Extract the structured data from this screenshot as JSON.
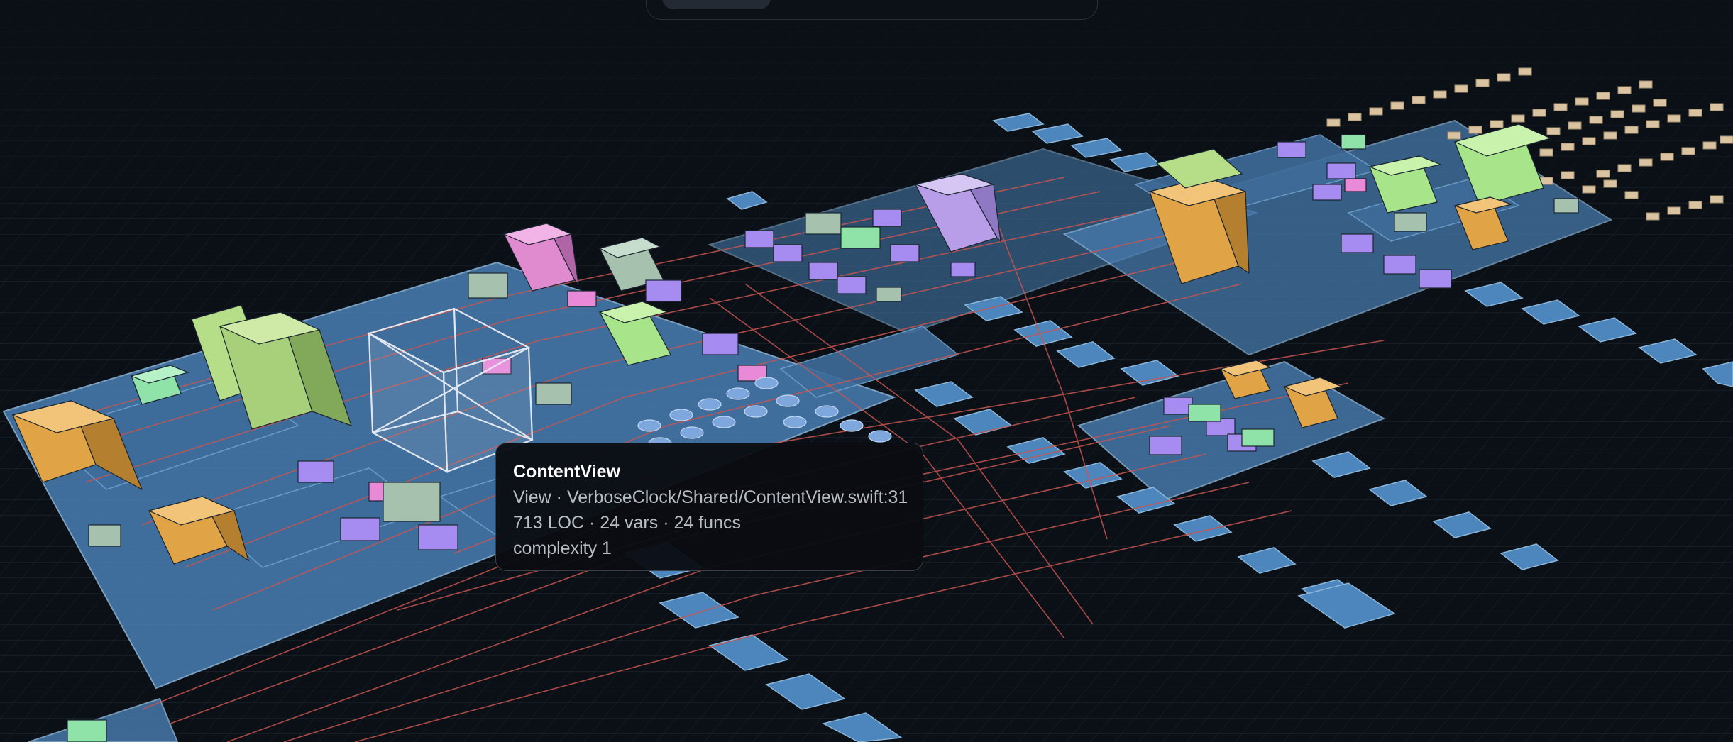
{
  "tooltip": {
    "title": "ContentView",
    "line1": "View · VerboseClock/Shared/ContentView.swift:31",
    "line2": "713 LOC · 24 vars · 24 funcs",
    "line3": "complexity 1"
  },
  "colors": {
    "background": "#0b1016",
    "platform": "#4a82b8",
    "connection": "#c0504a",
    "struct": "#e6a94a",
    "class": "#b6e08c",
    "protocol": "#a38bef",
    "enum": "#e68ad3",
    "extension": "#8fe3a8",
    "view": "#a6c2ae"
  },
  "icons": {
    "highlight": "wireframe-selection-box-icon"
  }
}
